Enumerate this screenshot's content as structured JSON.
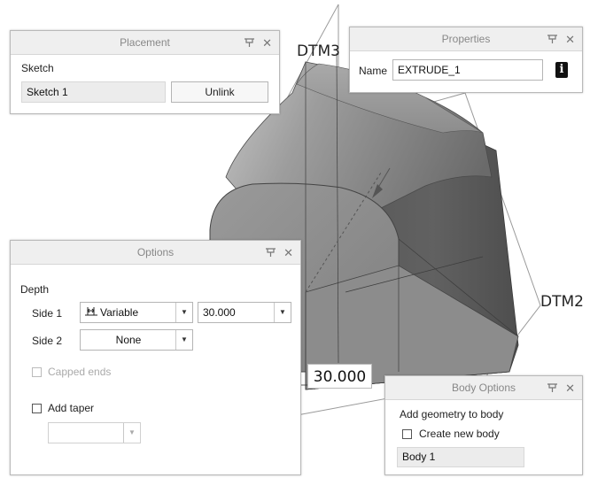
{
  "viewport": {
    "datum_top": "DTM3",
    "datum_right": "DTM2",
    "depth_dimension": "30.000"
  },
  "placement": {
    "title": "Placement",
    "sketch_label": "Sketch",
    "sketch_value": "Sketch 1",
    "unlink_button": "Unlink"
  },
  "properties": {
    "title": "Properties",
    "name_label": "Name",
    "name_value": "EXTRUDE_1",
    "info_icon": "i"
  },
  "options": {
    "title": "Options",
    "depth_label": "Depth",
    "side1_label": "Side 1",
    "side1_mode": "Variable",
    "side1_value": "30.000",
    "side2_label": "Side 2",
    "side2_mode": "None",
    "capped_ends_label": "Capped ends",
    "add_taper_label": "Add taper",
    "taper_value": ""
  },
  "body_options": {
    "title": "Body Options",
    "add_geometry_label": "Add geometry to body",
    "create_new_body_label": "Create new body",
    "body_value": "Body 1"
  },
  "icons": {
    "pin": "pin-icon",
    "close": "close-icon",
    "dropdown": "chevron-down-icon",
    "variable_depth": "variable-depth-icon",
    "info": "info-icon"
  },
  "colors": {
    "panel_title_bg": "#efefef",
    "panel_border": "#b9b9b9",
    "model_dark": "#5e5e5e",
    "model_mid": "#8a8a8a",
    "model_light": "#c4c4c4"
  }
}
